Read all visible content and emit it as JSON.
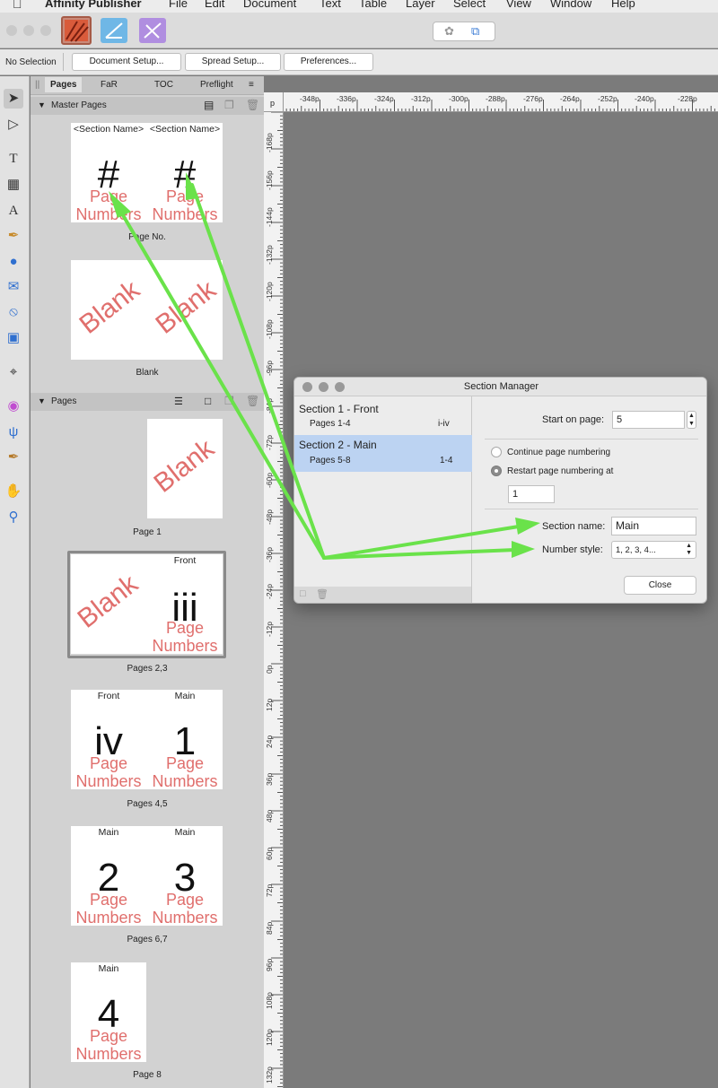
{
  "menubar": {
    "app_name": "Affinity Publisher",
    "items": [
      "File",
      "Edit",
      "Document",
      "Text",
      "Table",
      "Layer",
      "Select",
      "View",
      "Window",
      "Help"
    ]
  },
  "context_toolbar": {
    "selection_label": "No Selection",
    "buttons": [
      "Document Setup...",
      "Spread Setup...",
      "Preferences..."
    ]
  },
  "panel": {
    "tabs": [
      "Pages",
      "FaR",
      "TOC",
      "Preflight"
    ],
    "master_pages_title": "Master Pages",
    "pages_title": "Pages",
    "masters": [
      {
        "label": "Page No.",
        "left_header": "<Section Name>",
        "right_header": "<Section Name>",
        "symbol": "#",
        "field": "Page Numbers"
      },
      {
        "label": "Blank",
        "overlay": "Blank"
      }
    ],
    "spreads": [
      {
        "label": "Page 1",
        "overlay": "Blank"
      },
      {
        "label": "Pages 2,3",
        "left_overlay": "Blank",
        "right_header": "Front",
        "right_number": "iii",
        "field": "Page Numbers"
      },
      {
        "label": "Pages 4,5",
        "left_header": "Front",
        "left_number": "iv",
        "right_header": "Main",
        "right_number": "1",
        "field": "Page Numbers"
      },
      {
        "label": "Pages 6,7",
        "left_header": "Main",
        "left_number": "2",
        "right_header": "Main",
        "right_number": "3",
        "field": "Page Numbers"
      },
      {
        "label": "Page 8",
        "header": "Main",
        "number": "4",
        "field": "Page Numbers"
      }
    ]
  },
  "rulers": {
    "unit": "p",
    "top": [
      "-348p",
      "-336p",
      "-324p",
      "-312p",
      "-300p",
      "-288p",
      "-276p",
      "-264p",
      "-252p",
      "-240p",
      "-228p"
    ],
    "left": [
      "-168p",
      "-156p",
      "-144p",
      "-132p",
      "-120p",
      "-108p",
      "-96p",
      "-84p",
      "-72p",
      "-60p",
      "-48p",
      "-36p",
      "-24p",
      "-12p",
      "0p",
      "12p",
      "24p",
      "36p",
      "48p",
      "60p",
      "72p",
      "84p",
      "96p",
      "108p",
      "120p",
      "132p"
    ]
  },
  "dialog": {
    "title": "Section Manager",
    "sections": [
      {
        "name": "Section 1 - Front",
        "pages": "Pages 1-4",
        "range": "i-iv",
        "selected": false
      },
      {
        "name": "Section 2 - Main",
        "pages": "Pages 5-8",
        "range": "1-4",
        "selected": true
      }
    ],
    "start_on_page_label": "Start on page:",
    "start_on_page_value": "5",
    "continue_label": "Continue page numbering",
    "restart_label": "Restart page numbering at",
    "restart_value": "1",
    "section_name_label": "Section name:",
    "section_name_value": "Main",
    "number_style_label": "Number style:",
    "number_style_value": "1, 2, 3, 4...",
    "close_label": "Close"
  },
  "colors": {
    "annotation_arrow": "#6ae24a",
    "page_number_text": "#e06f6d",
    "selected_row": "#bcd3f2"
  }
}
